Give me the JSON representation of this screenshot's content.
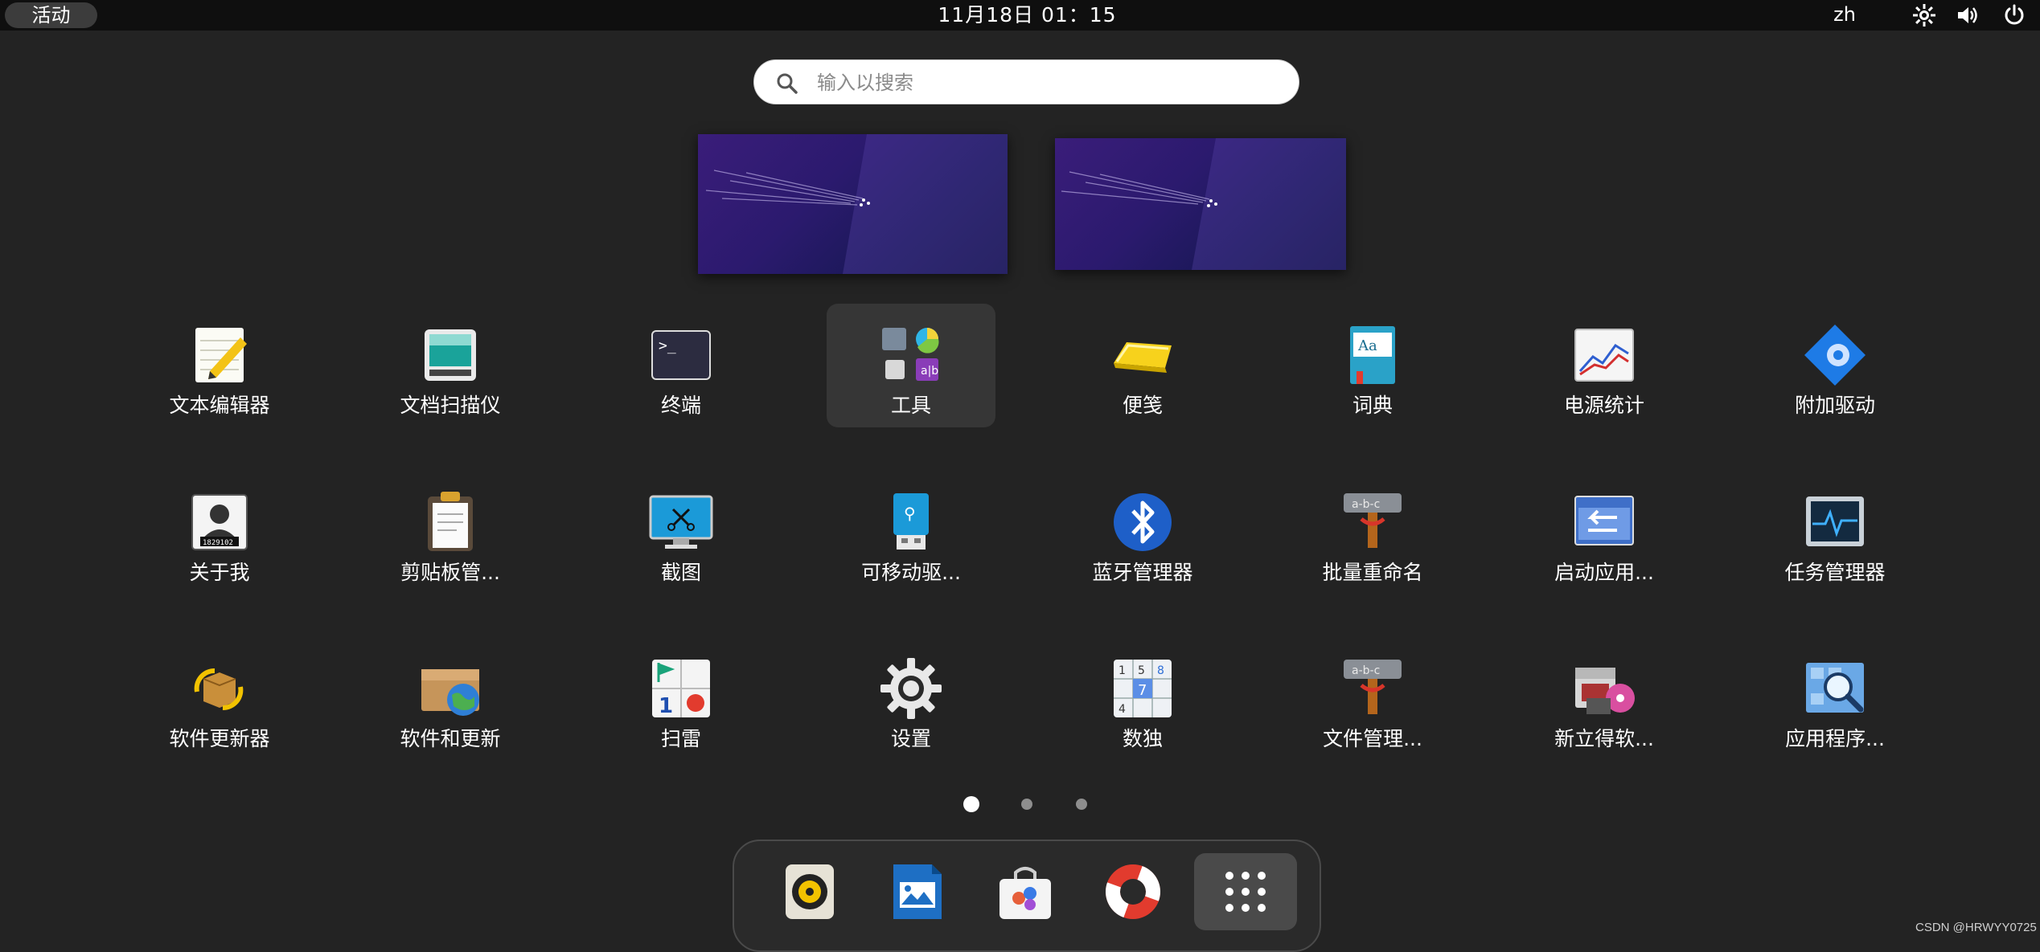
{
  "topbar": {
    "activities_label": "活动",
    "clock": "11月18日  01：15",
    "language": "zh",
    "tray_icons": [
      "accessibility-icon",
      "volume-icon",
      "power-icon"
    ]
  },
  "search": {
    "placeholder": "输入以搜索",
    "value": ""
  },
  "workspaces": [
    "workspace-1",
    "workspace-2"
  ],
  "apps": [
    {
      "label": "文本编辑器",
      "icon": "text-editor-icon"
    },
    {
      "label": "文档扫描仪",
      "icon": "document-scanner-icon"
    },
    {
      "label": "终端",
      "icon": "terminal-icon"
    },
    {
      "label": "工具",
      "icon": "utilities-folder-icon",
      "selected": true
    },
    {
      "label": "便笺",
      "icon": "sticky-notes-icon"
    },
    {
      "label": "词典",
      "icon": "dictionary-icon"
    },
    {
      "label": "电源统计",
      "icon": "power-statistics-icon"
    },
    {
      "label": "附加驱动",
      "icon": "additional-drivers-icon"
    },
    {
      "label": "关于我",
      "icon": "about-me-icon"
    },
    {
      "label": "剪贴板管...",
      "icon": "clipboard-manager-icon"
    },
    {
      "label": "截图",
      "icon": "screenshot-icon"
    },
    {
      "label": "可移动驱...",
      "icon": "removable-drive-icon"
    },
    {
      "label": "蓝牙管理器",
      "icon": "bluetooth-icon"
    },
    {
      "label": "批量重命名",
      "icon": "bulk-rename-icon"
    },
    {
      "label": "启动应用...",
      "icon": "startup-applications-icon"
    },
    {
      "label": "任务管理器",
      "icon": "task-manager-icon"
    },
    {
      "label": "软件更新器",
      "icon": "software-updater-icon"
    },
    {
      "label": "软件和更新",
      "icon": "software-sources-icon"
    },
    {
      "label": "扫雷",
      "icon": "minesweeper-icon"
    },
    {
      "label": "设置",
      "icon": "settings-gear-icon"
    },
    {
      "label": "数独",
      "icon": "sudoku-icon"
    },
    {
      "label": "文件管理...",
      "icon": "file-manager-icon"
    },
    {
      "label": "新立得软...",
      "icon": "synaptic-icon"
    },
    {
      "label": "应用程序...",
      "icon": "app-finder-icon"
    }
  ],
  "pager": {
    "pages": 3,
    "current": 1
  },
  "dock": [
    {
      "name": "rhythmbox",
      "icon": "music-player-icon"
    },
    {
      "name": "libreoffice-impress",
      "icon": "presentation-icon"
    },
    {
      "name": "software-center",
      "icon": "software-center-icon"
    },
    {
      "name": "help",
      "icon": "lifebuoy-help-icon"
    },
    {
      "name": "show-applications",
      "icon": "app-grid-icon"
    }
  ],
  "watermark": "CSDN @HRWYY0725"
}
